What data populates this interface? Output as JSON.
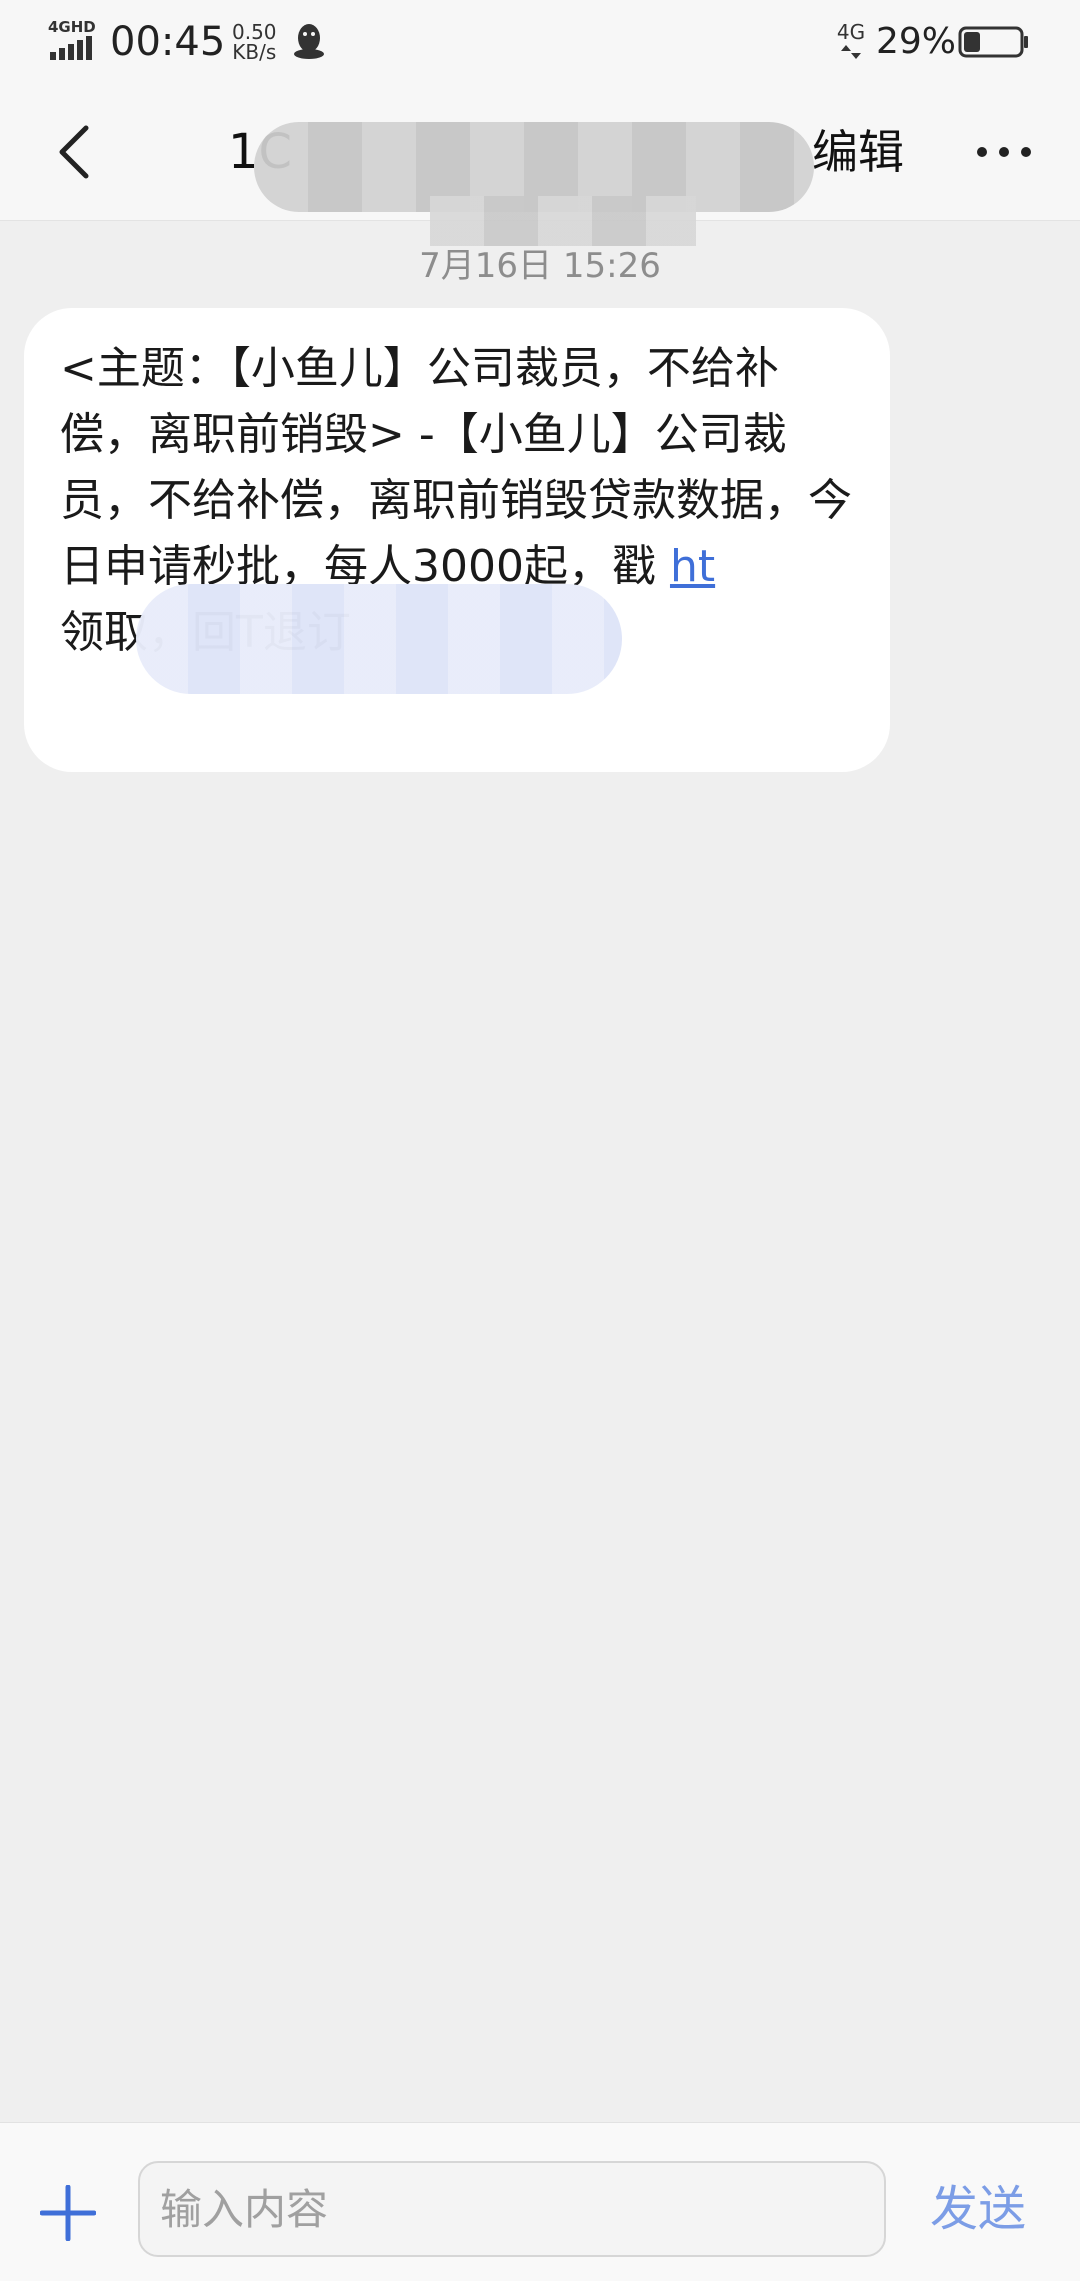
{
  "status_bar": {
    "network_label": "4GHD",
    "time": "00:45",
    "speed_value": "0.50",
    "speed_unit": "KB/s",
    "cell_label": "4G",
    "battery_percent": "29%",
    "battery_level": 0.29
  },
  "header": {
    "contact_prefix": "1C",
    "edit_label": "编辑"
  },
  "conversation": {
    "timestamp": "7月16日 15:26",
    "message": {
      "text_before_link": "<主题：【小鱼儿】公司裁员，不给补偿，离职前销毁> -【小鱼儿】公司裁员，不给补偿，离职前销毁贷款数据，今日申请秒批，每人3000起，戳 ",
      "link_text": "ht",
      "text_after_link": "                  领取，回T退订"
    }
  },
  "input_bar": {
    "placeholder": "输入内容",
    "send_label": "发送"
  },
  "colors": {
    "accent_link": "#3f6fd8",
    "send_button": "#7c9de6",
    "add_icon": "#3f6fd8",
    "background": "#efefef"
  }
}
